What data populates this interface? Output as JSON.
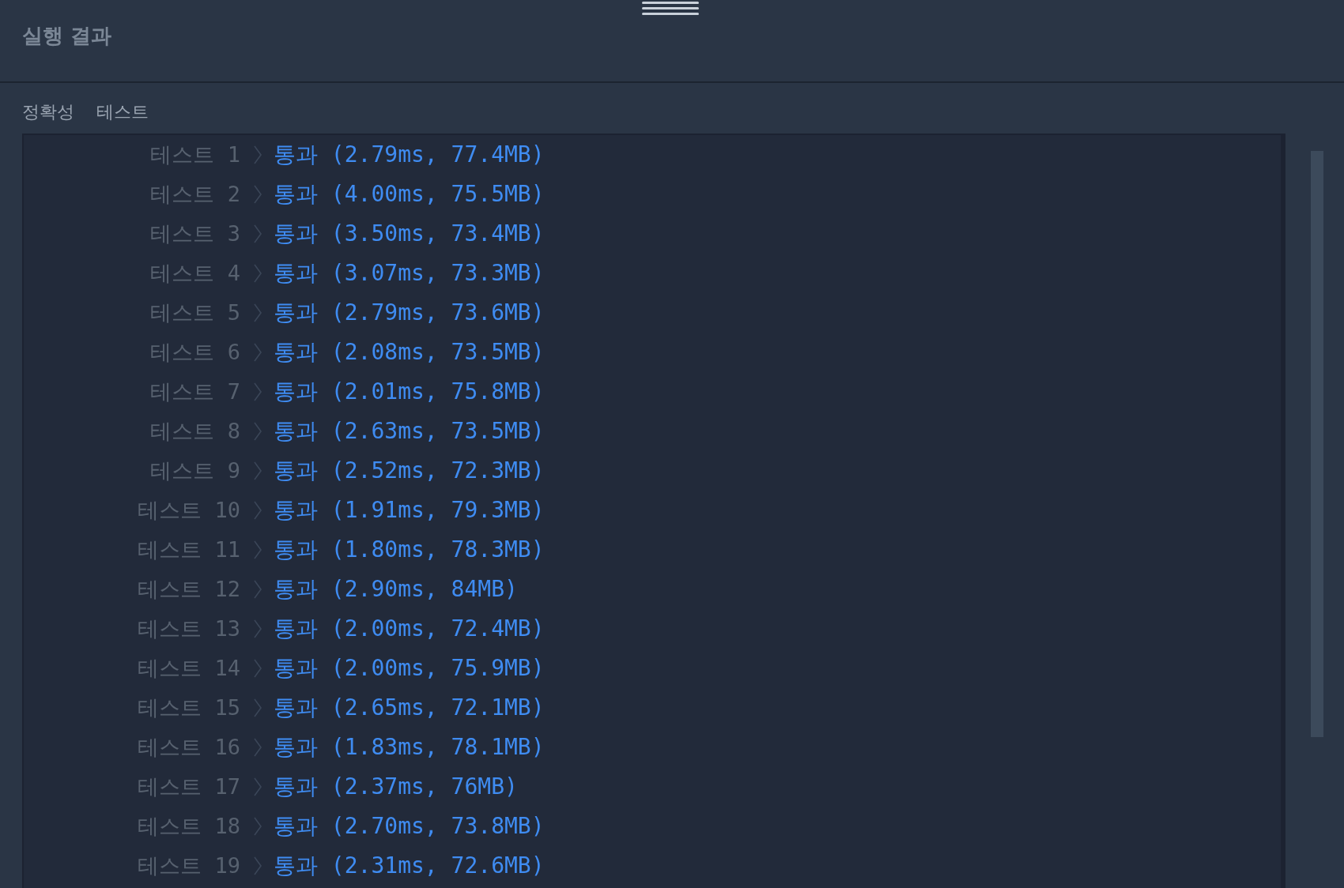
{
  "panel": {
    "title": "실행 결과"
  },
  "section": {
    "labels": [
      "정확성",
      "테스트"
    ]
  },
  "results": [
    {
      "label": "테스트 1",
      "result": "통과 (2.79ms, 77.4MB)"
    },
    {
      "label": "테스트 2",
      "result": "통과 (4.00ms, 75.5MB)"
    },
    {
      "label": "테스트 3",
      "result": "통과 (3.50ms, 73.4MB)"
    },
    {
      "label": "테스트 4",
      "result": "통과 (3.07ms, 73.3MB)"
    },
    {
      "label": "테스트 5",
      "result": "통과 (2.79ms, 73.6MB)"
    },
    {
      "label": "테스트 6",
      "result": "통과 (2.08ms, 73.5MB)"
    },
    {
      "label": "테스트 7",
      "result": "통과 (2.01ms, 75.8MB)"
    },
    {
      "label": "테스트 8",
      "result": "통과 (2.63ms, 73.5MB)"
    },
    {
      "label": "테스트 9",
      "result": "통과 (2.52ms, 72.3MB)"
    },
    {
      "label": "테스트 10",
      "result": "통과 (1.91ms, 79.3MB)"
    },
    {
      "label": "테스트 11",
      "result": "통과 (1.80ms, 78.3MB)"
    },
    {
      "label": "테스트 12",
      "result": "통과 (2.90ms, 84MB)"
    },
    {
      "label": "테스트 13",
      "result": "통과 (2.00ms, 72.4MB)"
    },
    {
      "label": "테스트 14",
      "result": "통과 (2.00ms, 75.9MB)"
    },
    {
      "label": "테스트 15",
      "result": "통과 (2.65ms, 72.1MB)"
    },
    {
      "label": "테스트 16",
      "result": "통과 (1.83ms, 78.1MB)"
    },
    {
      "label": "테스트 17",
      "result": "통과 (2.37ms, 76MB)"
    },
    {
      "label": "테스트 18",
      "result": "통과 (2.70ms, 73.8MB)"
    },
    {
      "label": "테스트 19",
      "result": "통과 (2.31ms, 72.6MB)"
    }
  ]
}
